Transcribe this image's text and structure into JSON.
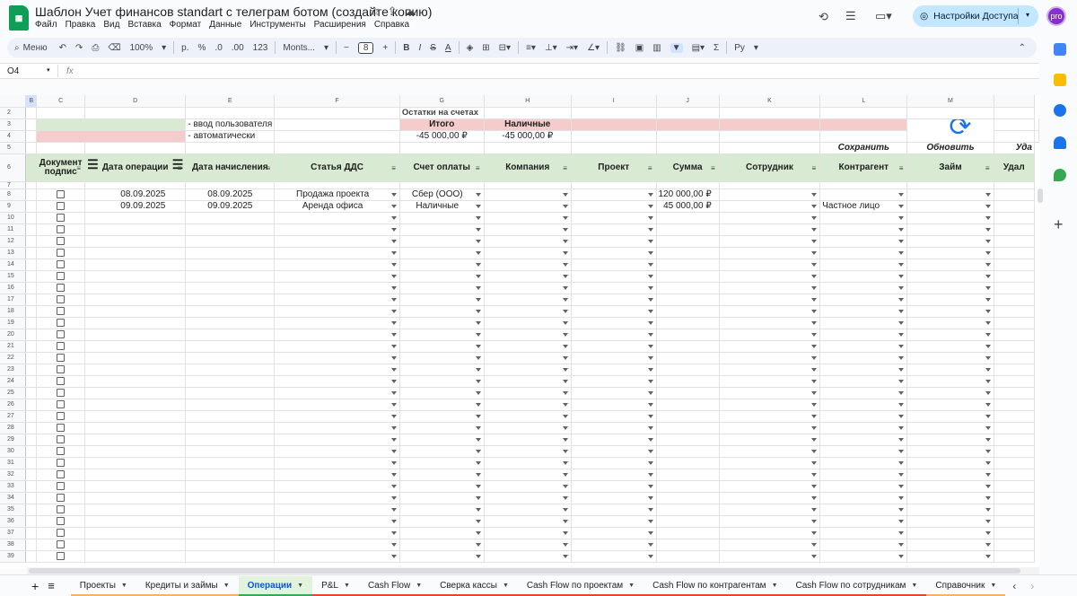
{
  "doc": {
    "title": "Шаблон Учет финансов standart с телеграм ботом (создайте копию)",
    "menus": [
      "Файл",
      "Правка",
      "Вид",
      "Вставка",
      "Формат",
      "Данные",
      "Инструменты",
      "Расширения",
      "Справка"
    ],
    "share_label": "Настройки Доступа",
    "avatar_text": "pro"
  },
  "toolbar": {
    "menu_search": "Меню",
    "zoom": "100%",
    "currency": "р.",
    "percent": "%",
    "dec_less": ".0",
    "dec_more": ".00",
    "format_123": "123",
    "font": "Monts...",
    "font_size": "8",
    "bold": "B",
    "italic": "I",
    "strike": "S",
    "text_color": "A",
    "sigma": "Σ",
    "input_tool": "Pу"
  },
  "formula_bar": {
    "cell_ref": "O4",
    "fx": "fx",
    "value": ""
  },
  "columns": [
    "B",
    "C",
    "D",
    "E",
    "F",
    "G",
    "H",
    "I",
    "J",
    "K",
    "L",
    "M",
    ""
  ],
  "legend": {
    "user_input": "- ввод пользователя",
    "auto": "- автоматически",
    "balances_title": "Остатки на счетах",
    "total_label": "Итого",
    "cash_label": "Наличные",
    "total_value": "-45 000,00 ₽",
    "cash_value": "-45 000,00 ₽",
    "save_btn": "Сохранить",
    "refresh_btn": "Обновить",
    "delete_btn": "Уда"
  },
  "headers": [
    "Документ подпис",
    "Дата операции",
    "Дата начисления",
    "Статья ДДС",
    "Счет оплаты",
    "Компания",
    "Проект",
    "Сумма",
    "Сотрудник",
    "Контрагент",
    "Займ",
    "Удал"
  ],
  "rows": [
    {
      "row": "8",
      "date_op": "08.09.2025",
      "date_acc": "08.09.2025",
      "article": "Продажа проекта",
      "account": "Сбер (ООО)",
      "company": "",
      "project": "",
      "amount": "120 000,00 ₽",
      "employee": "",
      "counterparty": "",
      "loan": ""
    },
    {
      "row": "9",
      "date_op": "09.09.2025",
      "date_acc": "09.09.2025",
      "article": "Аренда офиса",
      "account": "Наличные",
      "company": "",
      "project": "",
      "amount": "45 000,00 ₽",
      "employee": "",
      "counterparty": "Частное лицо",
      "loan": ""
    }
  ],
  "empty_rows": [
    "10",
    "11",
    "12",
    "13",
    "14",
    "15",
    "16",
    "17",
    "18",
    "19",
    "20",
    "21",
    "22",
    "23",
    "24",
    "25",
    "26",
    "27",
    "28",
    "29",
    "30",
    "31",
    "32",
    "33",
    "34",
    "35",
    "36",
    "37",
    "38",
    "39"
  ],
  "tabs": [
    {
      "label": "Проекты",
      "color": "#f6b26b"
    },
    {
      "label": "Кредиты и займы",
      "color": "#f6b26b"
    },
    {
      "label": "Операции",
      "color": "#34a853",
      "active": true
    },
    {
      "label": "P&L",
      "color": "#ea4335"
    },
    {
      "label": "Cash Flow",
      "color": "#ea4335"
    },
    {
      "label": "Сверка кассы",
      "color": "#ea4335"
    },
    {
      "label": "Cash Flow по проектам",
      "color": "#ea4335"
    },
    {
      "label": "Cash Flow по контрагентам",
      "color": "#ea4335"
    },
    {
      "label": "Cash Flow по сотрудникам",
      "color": "#ea4335"
    },
    {
      "label": "Справочник",
      "color": "#f6b26b"
    }
  ],
  "colors": {
    "header_green": "#d9ead3",
    "auto_pink": "#f4cccc",
    "accent": "#0b57d0",
    "share_bg": "#c2e7ff"
  }
}
